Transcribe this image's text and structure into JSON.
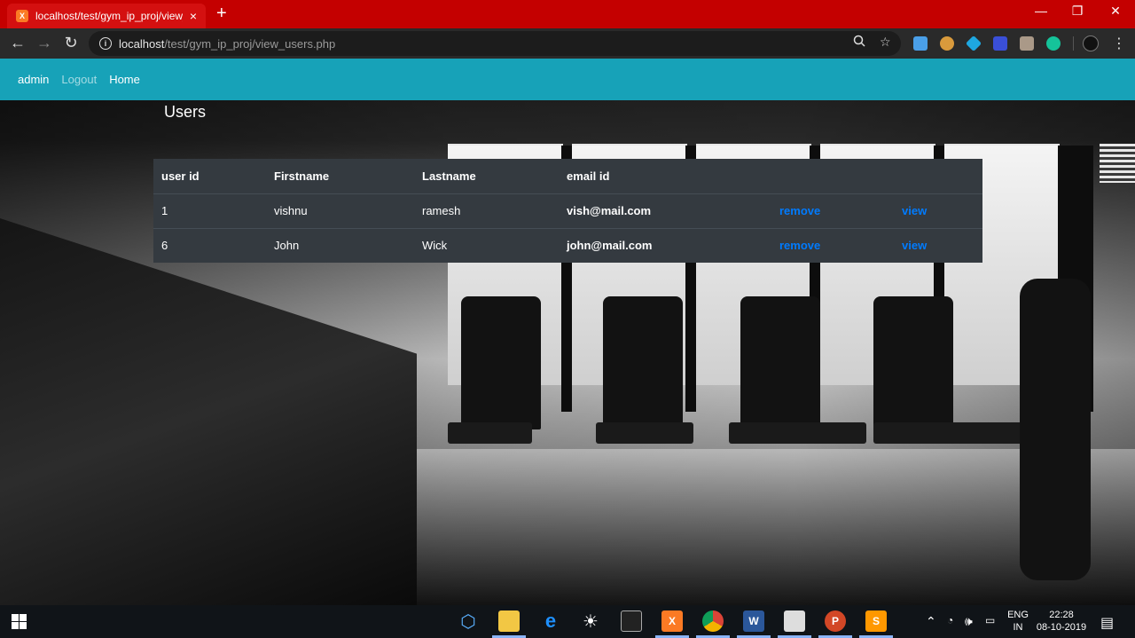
{
  "browser": {
    "tab_title": "localhost/test/gym_ip_proj/view_",
    "tab_favicon": "XAMPP",
    "tab_close": "×",
    "new_tab": "+",
    "url_host": "localhost",
    "url_path": "/test/gym_ip_proj/view_users.php",
    "window_minimize": "—",
    "window_maximize": "❐",
    "window_close": "✕"
  },
  "navbar": {
    "brand": "admin",
    "logout": "Logout",
    "home": "Home",
    "color": "#17a2b8"
  },
  "page": {
    "title": "Users"
  },
  "table": {
    "columns": [
      "user id",
      "Firstname",
      "Lastname",
      "email id",
      "",
      ""
    ],
    "rows": [
      {
        "user_id": "1",
        "firstname": "vishnu",
        "lastname": "ramesh",
        "email": "vish@mail.com",
        "remove": "remove",
        "view": "view"
      },
      {
        "user_id": "6",
        "firstname": "John",
        "lastname": "Wick",
        "email": "john@mail.com",
        "remove": "remove",
        "view": "view"
      }
    ],
    "link_color": "#007bff",
    "background": "#343a40"
  },
  "taskbar": {
    "language_top": "ENG",
    "language_bottom": "IN",
    "time": "22:28",
    "date": "08-10-2019"
  },
  "icons": [
    "back-icon",
    "forward-icon",
    "reload-icon",
    "info-icon",
    "zoom-icon",
    "star-icon",
    "windows-start-icon",
    "notification-icon"
  ]
}
